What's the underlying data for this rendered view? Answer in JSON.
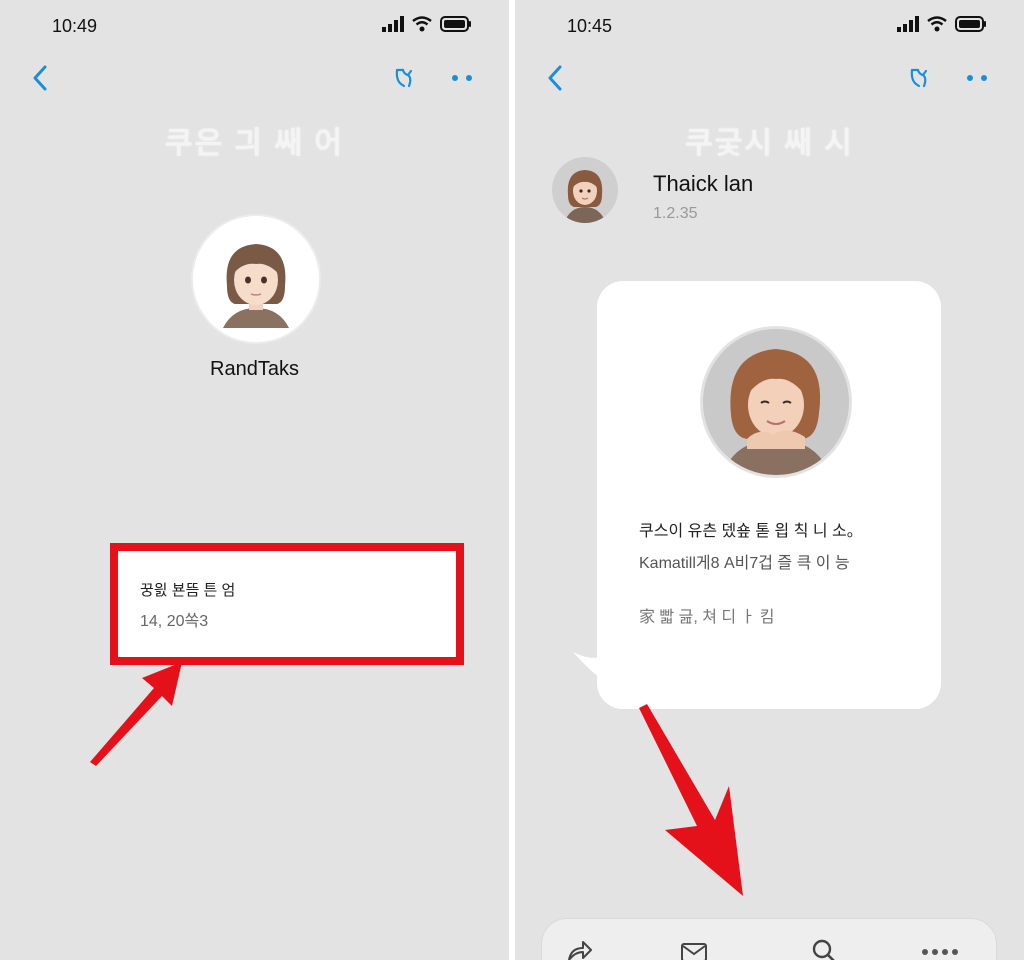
{
  "left_screen": {
    "status_time": "10:49",
    "title": "쿠은 긔 쌔 어",
    "profile_name": "RandTaks",
    "info_card": {
      "title": "꿍읤 뵨뜸 튼 엄",
      "subtitle": "14, 20쏙3"
    }
  },
  "right_screen": {
    "status_time": "10:45",
    "title": "쿠긏시 쌔 시",
    "sender": {
      "name": "Thaick lan",
      "time": "1.2.35"
    },
    "message": {
      "line1": "쿠스이 유츤 뎄숖 톧 읩 칙 니 소。",
      "line2": "Kamatill게8 A비7겁 즐 큭 이 능",
      "line3": "家 빫 긆,  쳐 디 ㅏ 킴"
    },
    "bottom_bar": [
      "share-icon",
      "mail-icon",
      "search-icon",
      "more-icon"
    ]
  },
  "colors": {
    "accent": "#1a8fd8",
    "highlight": "#e4111a",
    "background": "#e3e3e3"
  }
}
